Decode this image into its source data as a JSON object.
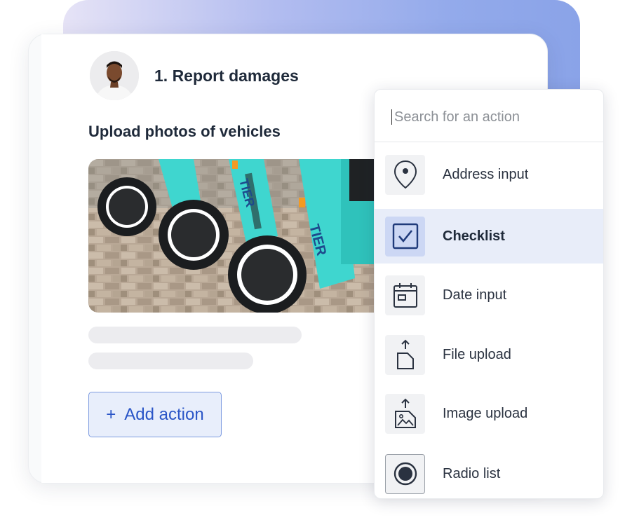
{
  "step": {
    "title": "1. Report damages",
    "subtitle": "Upload photos of vehicles",
    "add_action_icon": "+",
    "add_action_label": "Add action"
  },
  "photo": {
    "brand_text": "TIER"
  },
  "dropdown": {
    "search_placeholder": "Search for an action",
    "items": [
      {
        "label": "Address input",
        "icon": "map-pin-icon"
      },
      {
        "label": "Checklist",
        "icon": "checkbox-icon",
        "selected": true
      },
      {
        "label": "Date input",
        "icon": "calendar-icon"
      },
      {
        "label": "File upload",
        "icon": "file-upload-icon"
      },
      {
        "label": "Image upload",
        "icon": "image-upload-icon"
      },
      {
        "label": "Radio list",
        "icon": "radio-icon"
      }
    ]
  },
  "colors": {
    "accent": "#2a55c7",
    "selected_bg": "#e8edf9",
    "gradient_start": "#e6e3f6",
    "gradient_end": "#8aa3e8",
    "scooter_teal": "#3fd6cf"
  }
}
